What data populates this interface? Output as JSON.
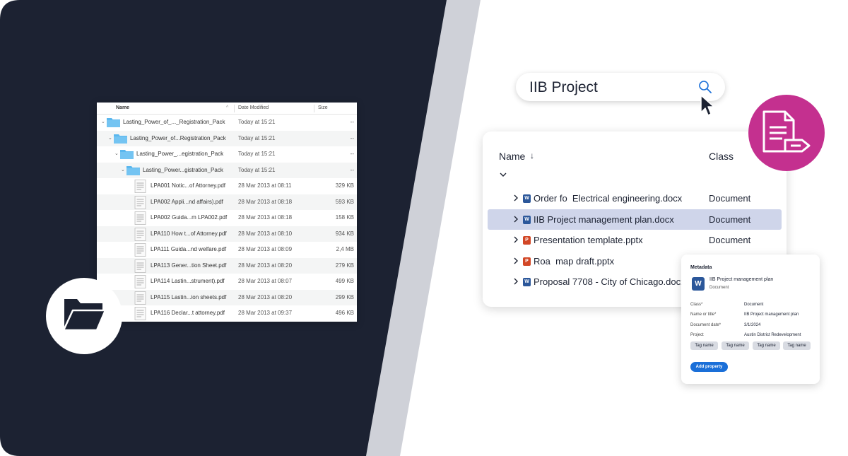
{
  "colors": {
    "navy": "#1c2232",
    "stripe": "#cfd1d8",
    "magenta": "#c4308f",
    "selection": "#cfd5ea",
    "word_blue": "#2b579a",
    "ppt_orange": "#d24726",
    "button_blue": "#1a6fd8",
    "folder_blue": "#5ab7ee"
  },
  "finder": {
    "headers": {
      "name": "Name",
      "date": "Date Modified",
      "size": "Size"
    },
    "rows": [
      {
        "name": "Lasting_Power_of_..._Registration_Pack",
        "date": "Today at 15:21",
        "size": "--",
        "kind": "folder",
        "level": 0
      },
      {
        "name": "Lasting_Power_of...Registration_Pack",
        "date": "Today at 15:21",
        "size": "--",
        "kind": "folder",
        "level": 1
      },
      {
        "name": "Lasting_Power_...egistration_Pack",
        "date": "Today at 15:21",
        "size": "--",
        "kind": "folder",
        "level": 2
      },
      {
        "name": "Lasting_Power...gistration_Pack",
        "date": "Today at 15:21",
        "size": "--",
        "kind": "folder",
        "level": 3
      },
      {
        "name": "LPA001 Notic...of Attorney.pdf",
        "date": "28 Mar 2013 at 08:11",
        "size": "329 KB",
        "kind": "file"
      },
      {
        "name": "LPA002 Appli...nd affairs).pdf",
        "date": "28 Mar 2013 at 08:18",
        "size": "593 KB",
        "kind": "file"
      },
      {
        "name": "LPA002 Guida...m LPA002.pdf",
        "date": "28 Mar 2013 at 08:18",
        "size": "158 KB",
        "kind": "file"
      },
      {
        "name": "LPA110 How t...of Attorney.pdf",
        "date": "28 Mar 2013 at 08:10",
        "size": "934 KB",
        "kind": "file"
      },
      {
        "name": "LPA111 Guida...nd welfare.pdf",
        "date": "28 Mar 2013 at 08:09",
        "size": "2,4 MB",
        "kind": "file"
      },
      {
        "name": "LPA113 Gener...tion Sheet.pdf",
        "date": "28 Mar 2013 at 08:20",
        "size": "279 KB",
        "kind": "file"
      },
      {
        "name": "LPA114 Lastin...strument).pdf",
        "date": "28 Mar 2013 at 08:07",
        "size": "499 KB",
        "kind": "file"
      },
      {
        "name": "LPA115 Lastin...ion sheets.pdf",
        "date": "28 Mar 2013 at 08:20",
        "size": "299 KB",
        "kind": "file"
      },
      {
        "name": "LPA116 Declar...t attorney.pdf",
        "date": "28 Mar 2013 at 09:37",
        "size": "496 KB",
        "kind": "file"
      }
    ]
  },
  "search": {
    "query": "IIB Project"
  },
  "results": {
    "headers": {
      "name": "Name",
      "class": "Class"
    },
    "rows": [
      {
        "name": "Order fo  Electrical engineering.docx",
        "class": "Document",
        "icon": "W",
        "type": "word",
        "selected": false
      },
      {
        "name": "IIB Project management plan.docx",
        "class": "Document",
        "icon": "W",
        "type": "word",
        "selected": true
      },
      {
        "name": "Presentation template.pptx",
        "class": "Document",
        "icon": "P",
        "type": "ppt",
        "selected": false
      },
      {
        "name": "Roa  map draft.pptx",
        "class": "",
        "icon": "P",
        "type": "ppt",
        "selected": false
      },
      {
        "name": "Proposal 7708 - City of Chicago.docx",
        "class": "",
        "icon": "W",
        "type": "word",
        "selected": false
      }
    ]
  },
  "metadata": {
    "title": "Metadata",
    "file_name": "IIB Project management plan",
    "file_type": "Document",
    "icon": "W",
    "properties": [
      {
        "label": "Class*",
        "value": "Document"
      },
      {
        "label": "Name or title*",
        "value": "IIB Project management plan"
      },
      {
        "label": "Document date*",
        "value": "3/1/2024"
      },
      {
        "label": "Project",
        "value": "Austin District Redevelopment"
      }
    ],
    "tags": [
      "Tag name",
      "Tag name",
      "Tag name",
      "Tag name"
    ],
    "add_property": "Add property"
  }
}
